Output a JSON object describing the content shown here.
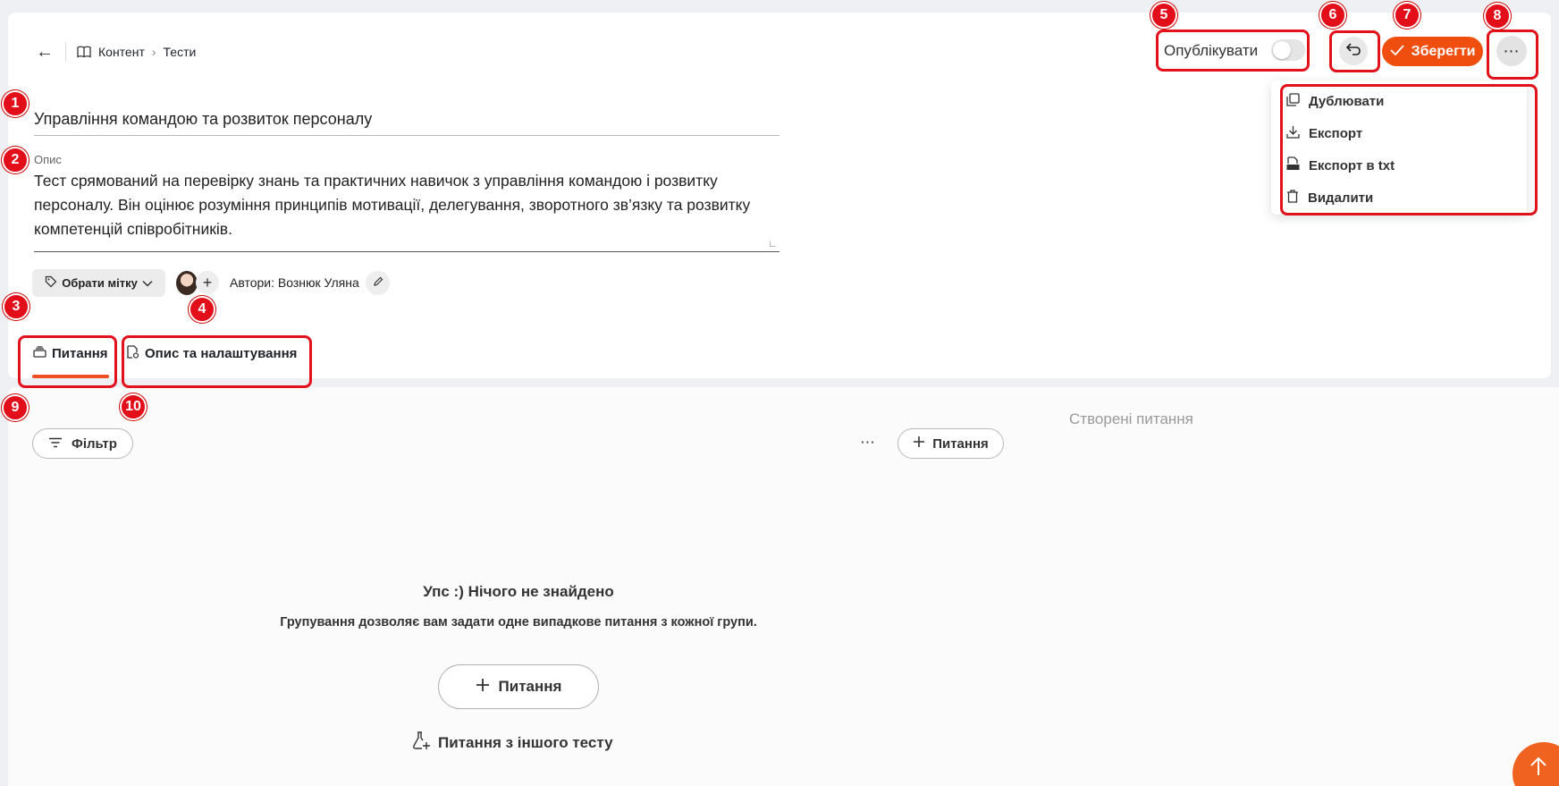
{
  "breadcrumb": {
    "items": [
      "Контент",
      "Тести"
    ]
  },
  "test": {
    "title": "Управління командою та розвиток персоналу",
    "description_label": "Опис",
    "description": "Тест срямований на перевірку знань та практичних навичок з управління командою і розвитку персоналу. Він оцінює розуміння принципів мотивації, делегування, зворотного зв’язку та розвитку компетенцій співробітників."
  },
  "meta": {
    "tag_button": "Обрати мітку",
    "authors_text": "Автори: Вознюк Уляна"
  },
  "tabs": [
    {
      "label": "Питання",
      "active": true
    },
    {
      "label": "Опис та налаштування",
      "active": false
    }
  ],
  "header_actions": {
    "publish_label": "Опублікувати",
    "publish_on": false,
    "save_label": "Зберегти"
  },
  "more_menu": {
    "items": [
      {
        "label": "Дублювати",
        "icon": "copy-icon"
      },
      {
        "label": "Експорт",
        "icon": "download-icon"
      },
      {
        "label": "Експорт в txt",
        "icon": "txt-file-icon"
      },
      {
        "label": "Видалити",
        "icon": "trash-icon"
      }
    ]
  },
  "questions": {
    "filter_label": "Фільтр",
    "add_label": "Питання",
    "created_title": "Створені питання",
    "empty_title": "Упс :) Нічого не знайдено",
    "empty_subtitle": "Групування дозволяє вам задати одне випадкове питання з кожної групи.",
    "add_big_label": "Питання",
    "from_other_test": "Питання з іншого тесту"
  },
  "annotations": [
    "1",
    "2",
    "3",
    "4",
    "5",
    "6",
    "7",
    "8",
    "9",
    "10"
  ],
  "colors": {
    "accent": "#f04e0f",
    "marker": "#e20f1a"
  }
}
